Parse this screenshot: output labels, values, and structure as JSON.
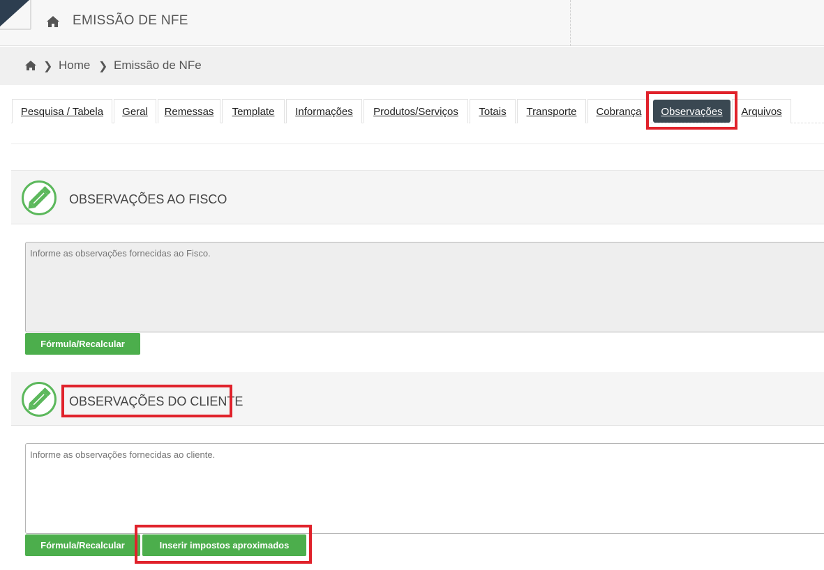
{
  "header": {
    "title": "EMISSÃO DE NFE",
    "home_icon": "home-icon"
  },
  "breadcrumb": {
    "home_icon": "home-icon",
    "items": [
      "Home",
      "Emissão de NFe"
    ]
  },
  "tabs": [
    {
      "label": "Pesquisa / Tabela"
    },
    {
      "label": "Geral"
    },
    {
      "label": "Remessas"
    },
    {
      "label": "Template"
    },
    {
      "label": "Informações"
    },
    {
      "label": "Produtos/Serviços"
    },
    {
      "label": "Totais"
    },
    {
      "label": "Transporte"
    },
    {
      "label": "Cobrança"
    },
    {
      "label": "Observações",
      "active": true
    },
    {
      "label": "Arquivos"
    }
  ],
  "sections": {
    "fisco": {
      "title": "OBSERVAÇÕES AO FISCO",
      "placeholder": "Informe as observações fornecidas ao Fisco.",
      "formula_button": "Fórmula/Recalcular"
    },
    "cliente": {
      "title": "OBSERVAÇÕES DO CLIENTE",
      "placeholder": "Informe as observações fornecidas ao cliente.",
      "formula_button": "Fórmula/Recalcular",
      "impostos_button": "Inserir impostos aproximados"
    }
  },
  "colors": {
    "accent_green": "#4cae4c",
    "active_tab": "#3a4852",
    "highlight_red": "#e0222b"
  }
}
